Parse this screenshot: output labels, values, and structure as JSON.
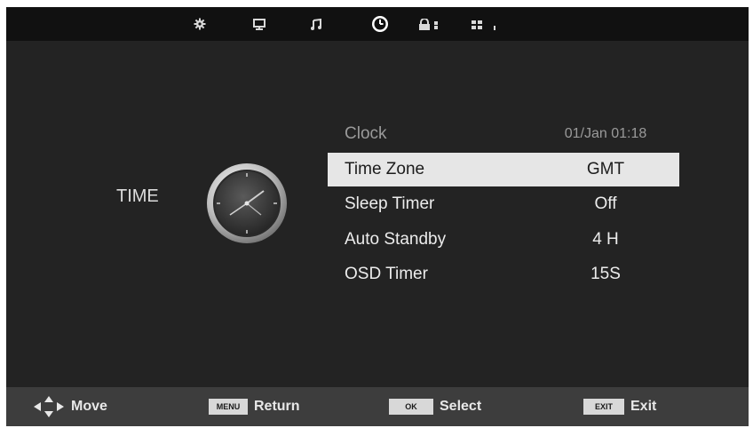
{
  "topbar": {
    "tabs": [
      {
        "icon": "gear-icon"
      },
      {
        "icon": "monitor-icon"
      },
      {
        "icon": "music-note-icon"
      },
      {
        "icon": "clock-icon",
        "active": true
      },
      {
        "icon": "lock-icon"
      },
      {
        "icon": "grid-icon"
      }
    ]
  },
  "page": {
    "title": "TIME"
  },
  "menu": {
    "items": [
      {
        "label": "Clock",
        "value": "01/Jan 01:18",
        "state": "disabled"
      },
      {
        "label": "Time Zone",
        "value": "GMT",
        "state": "selected"
      },
      {
        "label": "Sleep Timer",
        "value": "Off",
        "state": "normal"
      },
      {
        "label": "Auto Standby",
        "value": "4 H",
        "state": "normal"
      },
      {
        "label": "OSD Timer",
        "value": "15S",
        "state": "normal"
      }
    ]
  },
  "footer": {
    "move": {
      "label": "Move"
    },
    "return": {
      "key": "MENU",
      "label": "Return"
    },
    "select": {
      "key": "OK",
      "label": "Select"
    },
    "exit": {
      "key": "EXIT",
      "label": "Exit"
    }
  },
  "colors": {
    "background": "#232323",
    "highlight": "#e6e6e6",
    "bar": "#3d3d3d"
  }
}
